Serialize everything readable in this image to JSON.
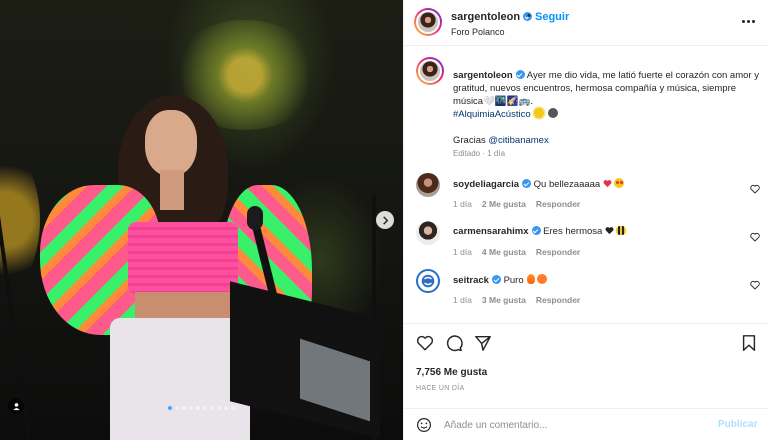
{
  "post": {
    "username": "sargentoleon",
    "follow_label": "Seguir",
    "separator": "•",
    "location": "Foro Polanco",
    "caption_username": "sargentoleon",
    "caption_text": "Ayer me dio vida, me latió fuerte el corazón con amor y gratitud, nuevos encuentros, hermosa compañía y música, siempre música",
    "caption_emoji_tail": "🤍🌃🌠🚌.",
    "hashtag": "#AlquimiaAcústico",
    "thanks_text": "Gracias",
    "thanks_mention": "@citibanamex",
    "edited_label": "Editado",
    "edited_time": "1 día"
  },
  "comments": [
    {
      "username": "soydeliagarcia",
      "text": "Qu bellezaaaaa",
      "time": "1 día",
      "likes": "2 Me gusta",
      "reply": "Responder",
      "emojis": [
        "heart",
        "star-struck"
      ]
    },
    {
      "username": "carmensarahimx",
      "text": "Eres hermosa",
      "time": "1 día",
      "likes": "4 Me gusta",
      "reply": "Responder",
      "emojis": [
        "black-heart",
        "bee"
      ]
    },
    {
      "username": "seitrack",
      "text": "Puro",
      "time": "1 día",
      "likes": "3 Me gusta",
      "reply": "Responder",
      "emojis": [
        "fire",
        "hot-face"
      ]
    }
  ],
  "actions": {
    "likes": "7,756 Me gusta",
    "time_ago": "HACE UN DÍA"
  },
  "comment_box": {
    "placeholder": "Añade un comentario...",
    "publish_label": "Publicar"
  },
  "carousel": {
    "slide_count": 10,
    "active_index": 0
  },
  "colors": {
    "accent": "#0095f6",
    "link": "#00376b",
    "verified": "#3897f0",
    "muted": "#8e8e8e"
  },
  "icons": [
    "chevron-right-icon",
    "user-tag-icon",
    "more-icon",
    "verified-icon",
    "heart-icon",
    "comment-icon",
    "share-icon",
    "bookmark-icon",
    "emoji-icon"
  ]
}
